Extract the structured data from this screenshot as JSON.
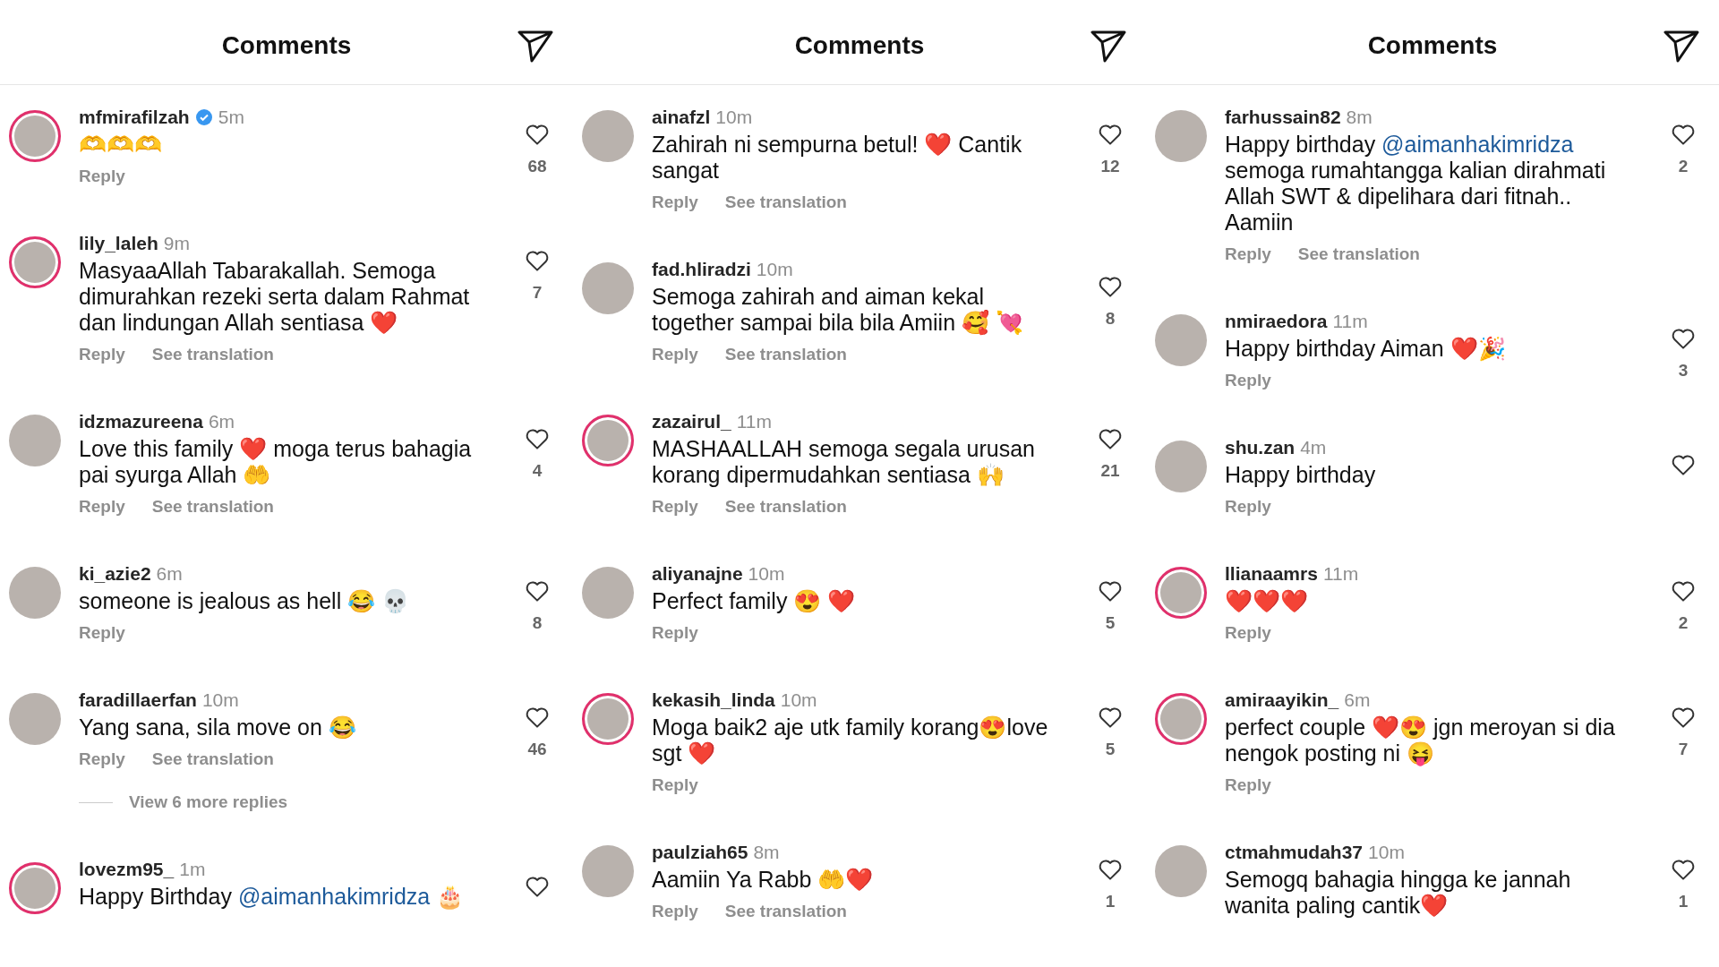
{
  "panels": [
    {
      "title": "Comments",
      "comments": [
        {
          "username": "mfmirafilzah",
          "verified": true,
          "story": true,
          "time": "5m",
          "text": "🫶🫶🫶",
          "actions": [
            "Reply"
          ],
          "likes": "68"
        },
        {
          "username": "lily_laleh",
          "verified": false,
          "story": true,
          "time": "9m",
          "text": "MasyaaAllah Tabarakallah. Semoga dimurahkan rezeki serta dalam Rahmat dan lindungan Allah sentiasa ❤️",
          "actions": [
            "Reply",
            "See translation"
          ],
          "likes": "7"
        },
        {
          "username": "idzmazureena",
          "verified": false,
          "story": false,
          "time": "6m",
          "text": "Love this family ❤️ moga terus bahagia pai syurga Allah 🤲",
          "actions": [
            "Reply",
            "See translation"
          ],
          "likes": "4"
        },
        {
          "username": "ki_azie2",
          "verified": false,
          "story": false,
          "time": "6m",
          "text": "someone is jealous as hell 😂 💀",
          "actions": [
            "Reply"
          ],
          "likes": "8"
        },
        {
          "username": "faradillaerfan",
          "verified": false,
          "story": false,
          "time": "10m",
          "text": "Yang sana, sila move on 😂",
          "actions": [
            "Reply",
            "See translation"
          ],
          "likes": "46",
          "more_replies": "View 6 more replies"
        },
        {
          "username": "lovezm95_",
          "verified": false,
          "story": true,
          "time": "1m",
          "segments": [
            {
              "kind": "plain",
              "text": "Happy Birthday "
            },
            {
              "kind": "mention",
              "text": "@aimanhakimridza"
            },
            {
              "kind": "plain",
              "text": " 🎂"
            }
          ]
        }
      ]
    },
    {
      "title": "Comments",
      "comments": [
        {
          "username": "ainafzl",
          "verified": false,
          "story": false,
          "time": "10m",
          "text": "Zahirah ni sempurna betul! ❤️ Cantik sangat",
          "actions": [
            "Reply",
            "See translation"
          ],
          "likes": "12"
        },
        {
          "username": "fad.hliradzi",
          "verified": false,
          "story": false,
          "time": "10m",
          "text": "Semoga zahirah and aiman kekal together sampai bila bila Amiin 🥰 💘",
          "actions": [
            "Reply",
            "See translation"
          ],
          "likes": "8"
        },
        {
          "username": "zazairul_",
          "verified": false,
          "story": true,
          "time": "11m",
          "text": "MASHAALLAH semoga segala urusan korang dipermudahkan sentiasa 🙌",
          "actions": [
            "Reply",
            "See translation"
          ],
          "likes": "21"
        },
        {
          "username": "aliyanajne",
          "verified": false,
          "story": false,
          "time": "10m",
          "text": "Perfect family 😍 ❤️",
          "actions": [
            "Reply"
          ],
          "likes": "5"
        },
        {
          "username": "kekasih_linda",
          "verified": false,
          "story": true,
          "time": "10m",
          "text": "Moga baik2 aje utk family korang😍love sgt ❤️",
          "actions": [
            "Reply"
          ],
          "likes": "5"
        },
        {
          "username": "paulziah65",
          "verified": false,
          "story": false,
          "time": "8m",
          "text": "Aamiin Ya Rabb 🤲❤️",
          "actions": [
            "Reply",
            "See translation"
          ],
          "likes": "1"
        }
      ]
    },
    {
      "title": "Comments",
      "comments": [
        {
          "username": "farhussain82",
          "verified": false,
          "story": false,
          "time": "8m",
          "segments": [
            {
              "kind": "plain",
              "text": "Happy birthday "
            },
            {
              "kind": "mention",
              "text": "@aimanhakimridza"
            },
            {
              "kind": "plain",
              "text": " semoga rumahtangga kalian dirahmati Allah SWT & dipelihara dari fitnah.. Aamiin"
            }
          ],
          "actions": [
            "Reply",
            "See translation"
          ],
          "likes": "2"
        },
        {
          "username": "nmiraedora",
          "verified": false,
          "story": false,
          "time": "11m",
          "text": "Happy birthday Aiman ❤️🎉",
          "actions": [
            "Reply"
          ],
          "likes": "3"
        },
        {
          "username": "shu.zan",
          "verified": false,
          "story": false,
          "time": "4m",
          "text": "Happy birthday",
          "actions": [
            "Reply"
          ]
        },
        {
          "username": "llianaamrs",
          "verified": false,
          "story": true,
          "time": "11m",
          "text": "❤️❤️❤️",
          "actions": [
            "Reply"
          ],
          "likes": "2"
        },
        {
          "username": "amiraayikin_",
          "verified": false,
          "story": true,
          "time": "6m",
          "text": "perfect couple ❤️😍 jgn meroyan si dia nengok posting ni 😝",
          "actions": [
            "Reply"
          ],
          "likes": "7"
        },
        {
          "username": "ctmahmudah37",
          "verified": false,
          "story": false,
          "time": "10m",
          "text": "Semogq bahagia hingga ke jannah wanita paling cantik❤️",
          "likes": "1"
        }
      ]
    }
  ]
}
